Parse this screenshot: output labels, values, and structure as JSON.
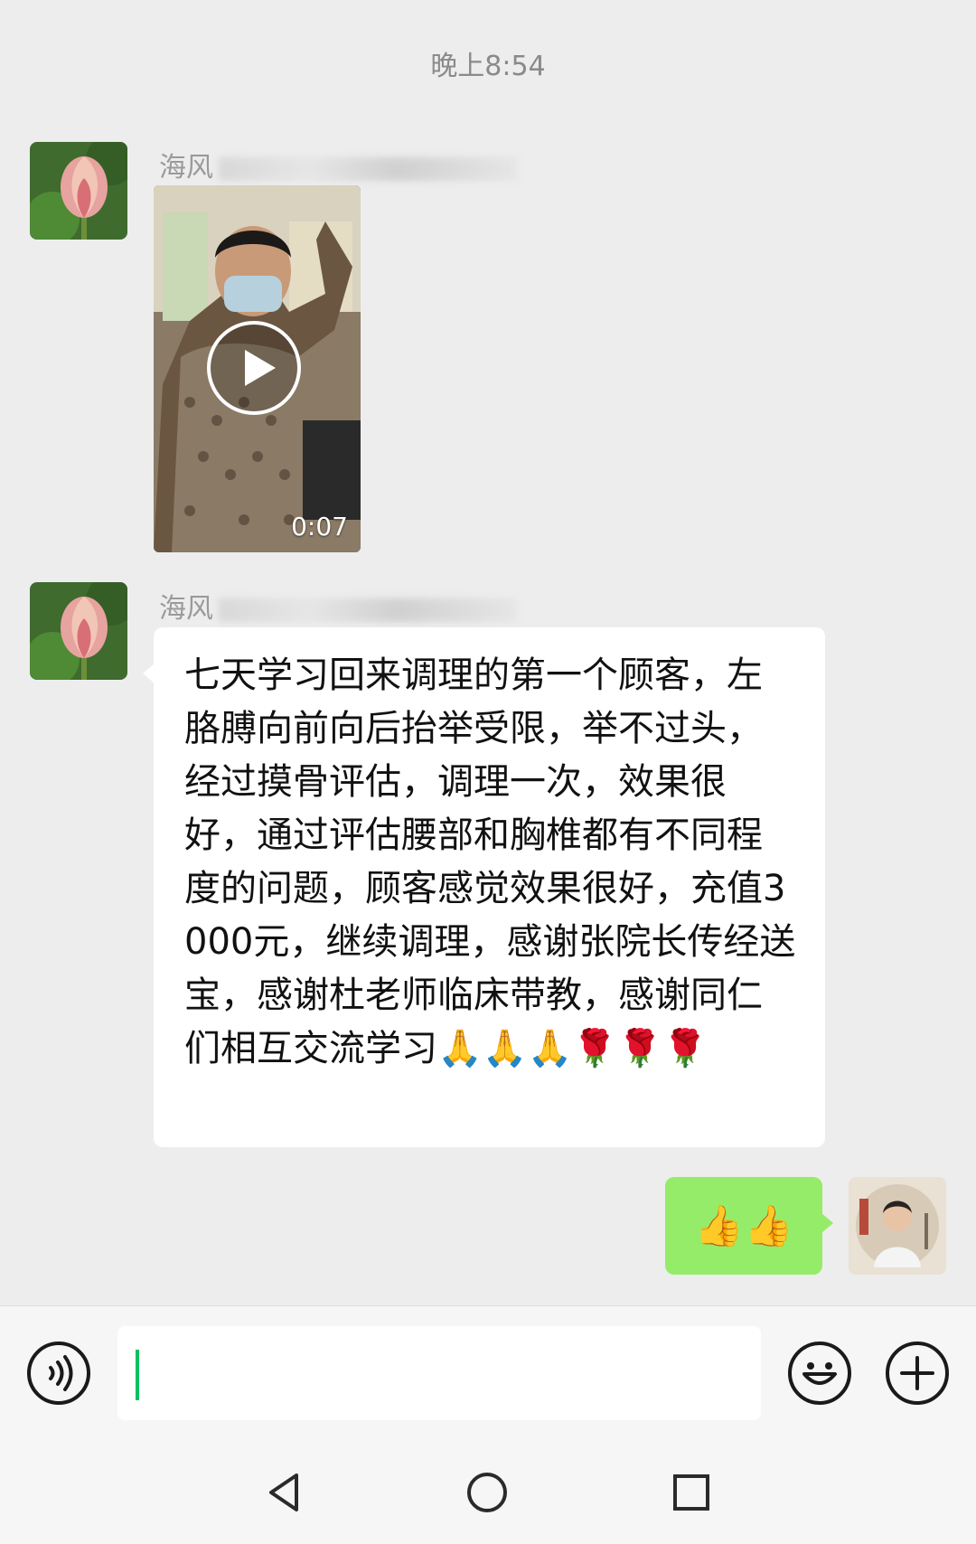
{
  "timestamp": "晚上8:54",
  "messages": [
    {
      "sender_visible": "海风",
      "type": "video",
      "duration": "0:07"
    },
    {
      "sender_visible": "海风",
      "type": "text",
      "text": "七天学习回来调理的第一个顾客，左胳膊向前向后抬举受限，举不过头，经过摸骨评估，调理一次，效果很好，通过评估腰部和胸椎都有不同程度的问题，顾客感觉效果很好，充值3000元，继续调理，感谢张院长传经送宝，感谢杜老师临床带教，感谢同仁们相互交流学习🙏🙏🙏🌹🌹🌹"
    },
    {
      "type": "sent",
      "text": "👍👍"
    }
  ],
  "input": {
    "value": ""
  },
  "colors": {
    "background": "#ededed",
    "sent_bubble": "#95ec69",
    "received_bubble": "#ffffff",
    "caret": "#07c160"
  },
  "icons": [
    "voice-icon",
    "emoji-icon",
    "plus-icon",
    "back-nav-icon",
    "home-nav-icon",
    "recents-nav-icon"
  ]
}
